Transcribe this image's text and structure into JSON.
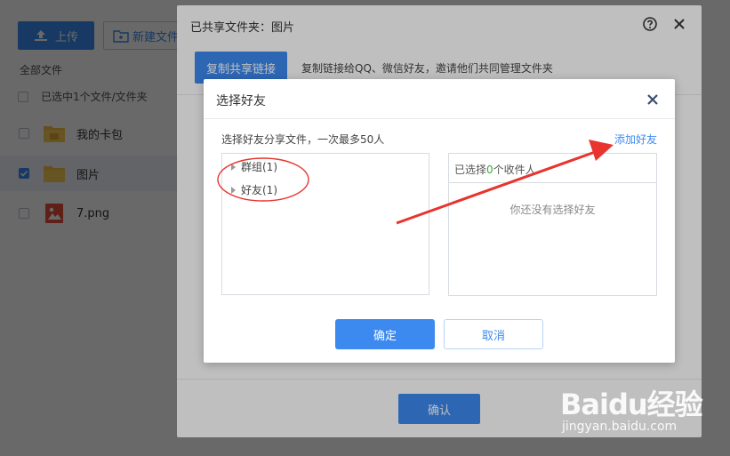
{
  "toolbar": {
    "upload_label": "上传",
    "new_folder_label": "新建文件"
  },
  "file_list": {
    "breadcrumb": "全部文件",
    "selection_text": "已选中1个文件/文件夹",
    "files": [
      {
        "name": "我的卡包",
        "type": "folder",
        "selected": false
      },
      {
        "name": "图片",
        "type": "folder",
        "selected": true
      },
      {
        "name": "7.png",
        "type": "image",
        "selected": false
      }
    ]
  },
  "share_dialog": {
    "title": "已共享文件夹：图片",
    "copy_button": "复制共享链接",
    "copy_description": "复制链接给QQ、微信好友，邀请他们共同管理文件夹",
    "confirm_button": "确认"
  },
  "friend_dialog": {
    "title": "选择好友",
    "hint": "选择好友分享文件，一次最多50人",
    "add_friend_link": "添加好友",
    "groups": [
      {
        "label": "群组(1)"
      },
      {
        "label": "好友(1)"
      }
    ],
    "selected_prefix": "已选择",
    "selected_count": "0",
    "selected_suffix": "个收件人",
    "empty_text": "你还没有选择好友",
    "ok_button": "确定",
    "cancel_button": "取消"
  },
  "watermark": {
    "logo": "Baidu经验",
    "url": "jingyan.baidu.com"
  },
  "colors": {
    "accent": "#3c8af0",
    "annotation": "#e8342f",
    "count_green": "#3aa832"
  }
}
